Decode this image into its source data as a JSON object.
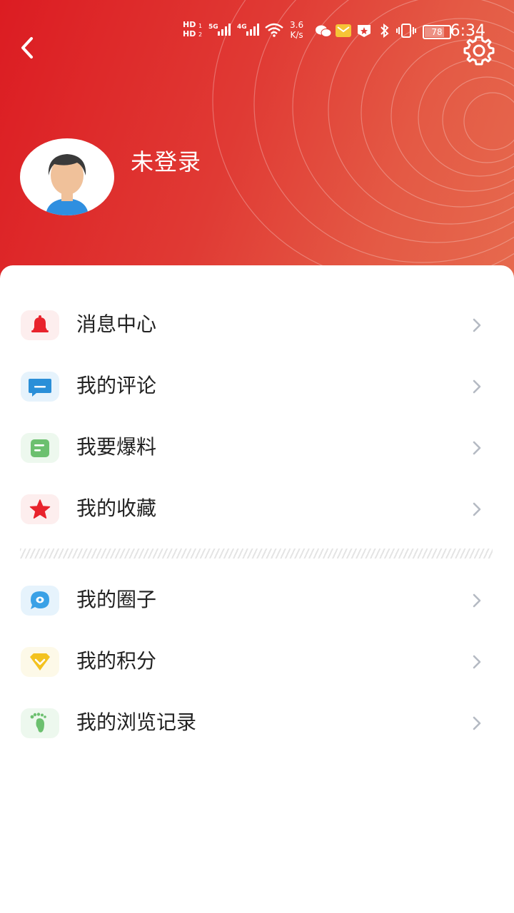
{
  "status_bar": {
    "hd1": "HD",
    "hd2": "HD",
    "net1": "5G",
    "net2": "4G",
    "speed_value": "3.6",
    "speed_unit": "K/s",
    "battery": "78",
    "time": "6:34"
  },
  "header": {
    "username": "未登录",
    "back_icon": "chevron-left-icon",
    "settings_icon": "gear-icon",
    "colors": {
      "start": "#dc1c22",
      "end": "#e66a4e"
    }
  },
  "menu": {
    "group1": [
      {
        "label": "消息中心",
        "icon": "bell-icon",
        "color": "#e8232c",
        "bg": "#fdeeee"
      },
      {
        "label": "我的评论",
        "icon": "comment-icon",
        "color": "#2a8fd8",
        "bg": "#e6f3fc"
      },
      {
        "label": "我要爆料",
        "icon": "note-icon",
        "color": "#6cc06f",
        "bg": "#edf8ee"
      },
      {
        "label": "我的收藏",
        "icon": "star-icon",
        "color": "#e8232c",
        "bg": "#fdeeee"
      }
    ],
    "group2": [
      {
        "label": "我的圈子",
        "icon": "circle-chat-icon",
        "color": "#3aa1e6",
        "bg": "#e6f3fc"
      },
      {
        "label": "我的积分",
        "icon": "diamond-icon",
        "color": "#f3c21f",
        "bg": "#fdf9e8"
      },
      {
        "label": "我的浏览记录",
        "icon": "footprint-icon",
        "color": "#6cc06f",
        "bg": "#edf8ee"
      }
    ]
  }
}
